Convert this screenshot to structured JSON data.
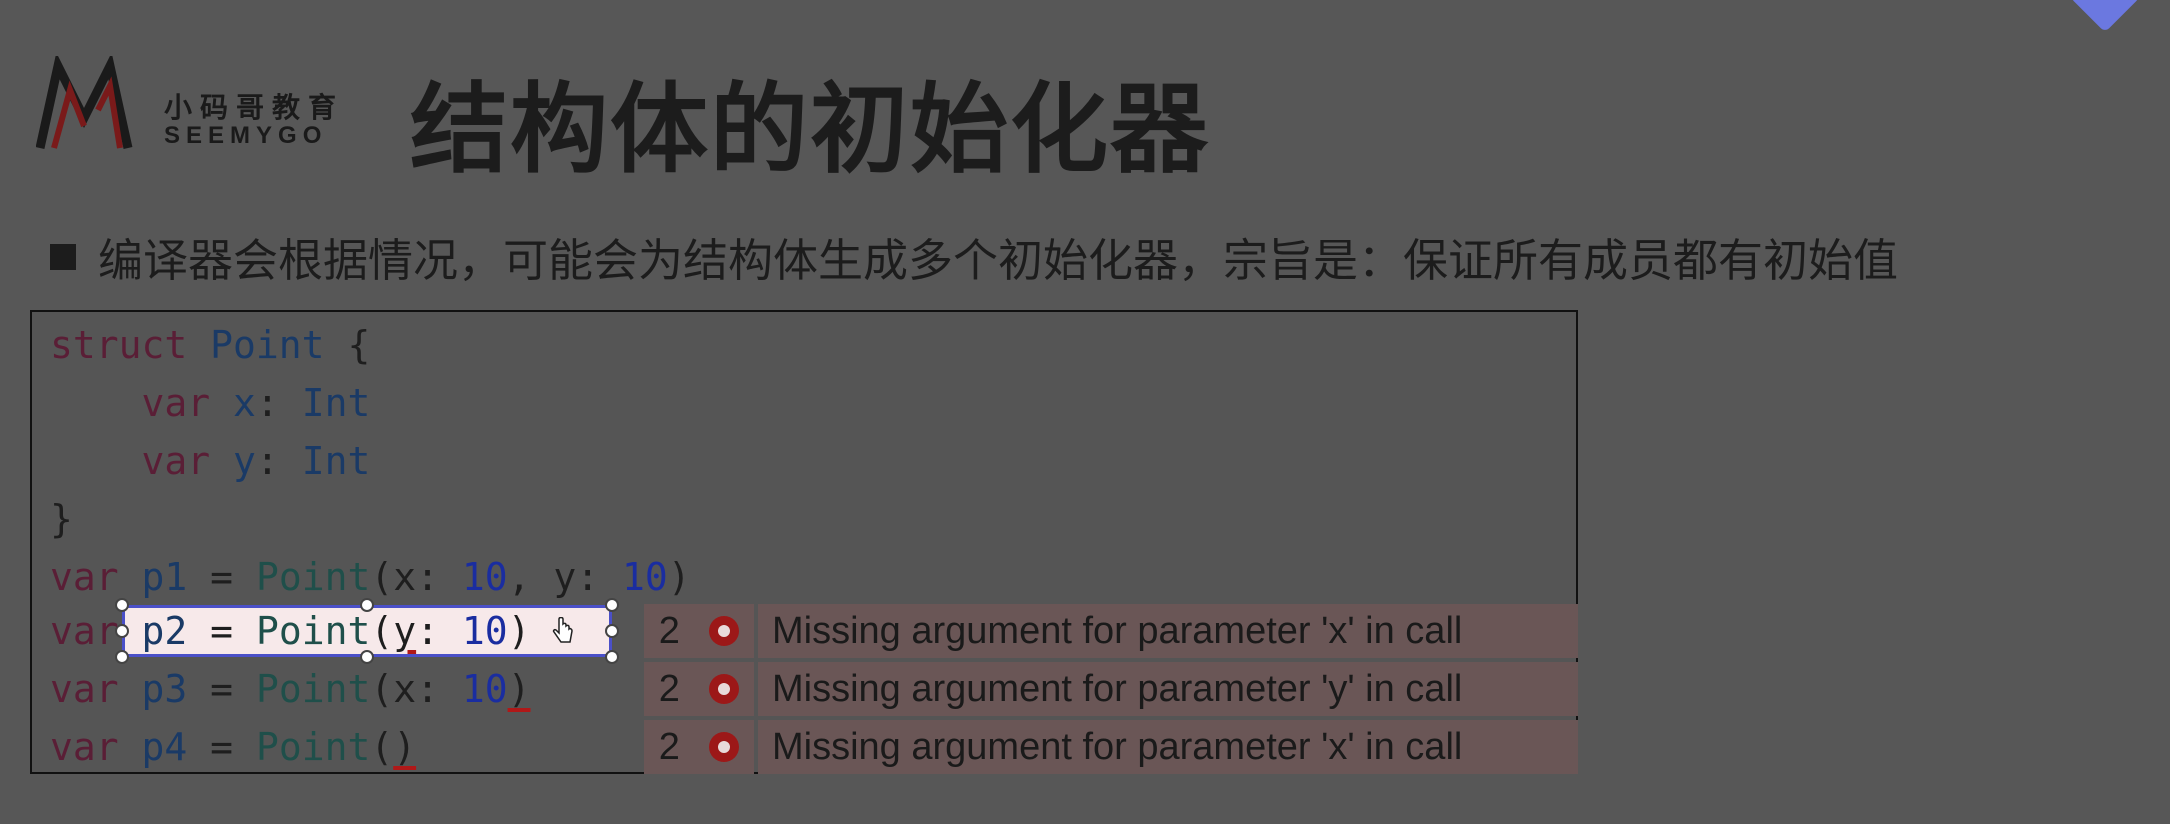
{
  "logo": {
    "cn_text": "小码哥教育",
    "en_text": "SEEMYGO"
  },
  "slide": {
    "title": "结构体的初始化器",
    "bullet": "编译器会根据情况，可能会为结构体生成多个初始化器，宗旨是：保证所有成员都有初始值"
  },
  "code": {
    "line1": {
      "kw": "struct",
      "type": "Point",
      "rest": " {"
    },
    "line2": {
      "kw": "var",
      "name": "x",
      "sep": ": ",
      "type": "Int"
    },
    "line3": {
      "kw": "var",
      "name": "y",
      "sep": ": ",
      "type": "Int"
    },
    "line4": {
      "text": "}"
    },
    "line5": {
      "kw": "var",
      "name": "p1",
      "eq": " = ",
      "fn": "Point",
      "args": "(x: ",
      "n1": "10",
      "mid": ", y: ",
      "n2": "10",
      "end": ")"
    },
    "line6": {
      "kw": "var",
      "name": "p2",
      "eq": " = ",
      "fn": "Point",
      "open": "(",
      "arg": "y",
      "colon": ": ",
      "n1": "10",
      "end": ")"
    },
    "line7": {
      "kw": "var",
      "name": "p3",
      "eq": " = ",
      "fn": "Point",
      "args": "(x: ",
      "n1": "10",
      "end": ")"
    },
    "line8": {
      "kw": "var",
      "name": "p4",
      "eq": " = ",
      "fn": "Point",
      "open": "(",
      "end": ")"
    }
  },
  "errors": [
    {
      "count": "2",
      "message": "Missing argument for parameter 'x' in call"
    },
    {
      "count": "2",
      "message": "Missing argument for parameter 'y' in call"
    },
    {
      "count": "2",
      "message": "Missing argument for parameter 'x' in call"
    }
  ],
  "colors": {
    "background": "#575757",
    "error_icon": "#9c1818",
    "selection_border": "#4b50c8"
  }
}
